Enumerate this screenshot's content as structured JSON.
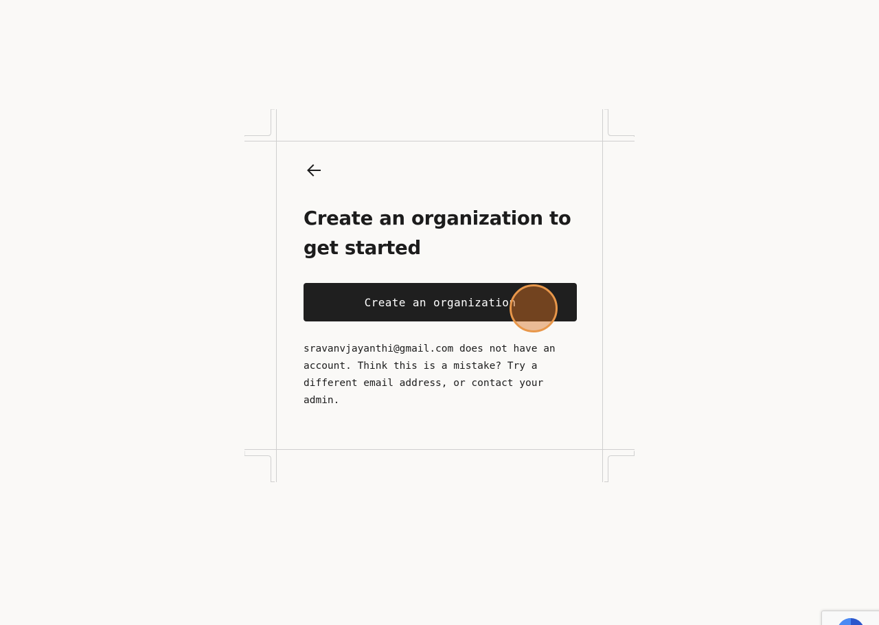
{
  "back": {
    "icon": "arrow-left-icon"
  },
  "heading": "Create an organization to get started",
  "primary_button": {
    "label": "Create an organization"
  },
  "message": "sravanvjayanthi@gmail.com does not have an account. Think this is a mistake? Try a different email address, or contact your admin.",
  "colors": {
    "background": "#faf9f7",
    "button": "#1f1f1f",
    "text": "#1c1c1c",
    "frame": "#cfcfcf",
    "cursor_highlight": "#e8974a"
  },
  "badge": {
    "icon": "recaptcha-icon"
  }
}
